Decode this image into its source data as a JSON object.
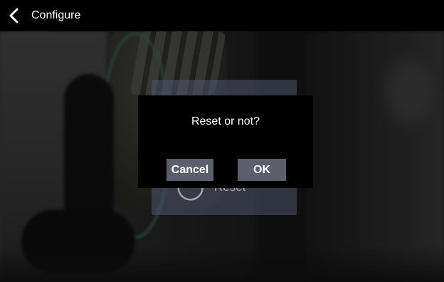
{
  "header": {
    "back_icon": "chevron-left-icon",
    "title": "Configure"
  },
  "reset_card": {
    "icon": "refresh-icon",
    "label": "Reset"
  },
  "dialog": {
    "message": "Reset or not?",
    "cancel_label": "Cancel",
    "ok_label": "OK"
  },
  "colors": {
    "header_bg": "#000000",
    "dialog_bg": "#000000",
    "button_bg": "#5a5f6b",
    "card_bg": "#7884a8"
  }
}
